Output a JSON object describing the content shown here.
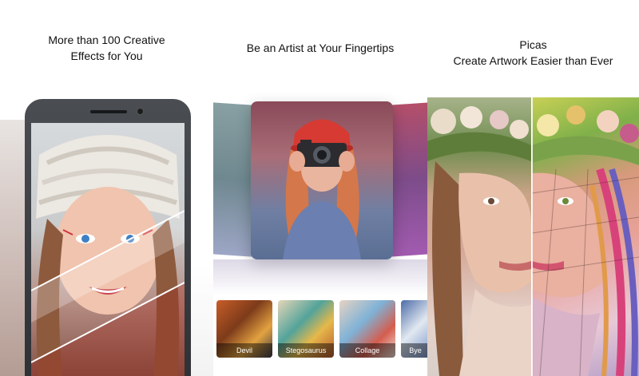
{
  "panels": [
    {
      "headline": [
        "More than 100 Creative",
        "Effects for You"
      ]
    },
    {
      "headline": [
        "Be an Artist at Your Fingertips"
      ],
      "effects": [
        {
          "label": "Devil"
        },
        {
          "label": "Stegosaurus"
        },
        {
          "label": "Collage"
        },
        {
          "label": "Bye"
        }
      ]
    },
    {
      "headline": [
        "Picas",
        "Create Artwork Easier than Ever"
      ]
    }
  ]
}
